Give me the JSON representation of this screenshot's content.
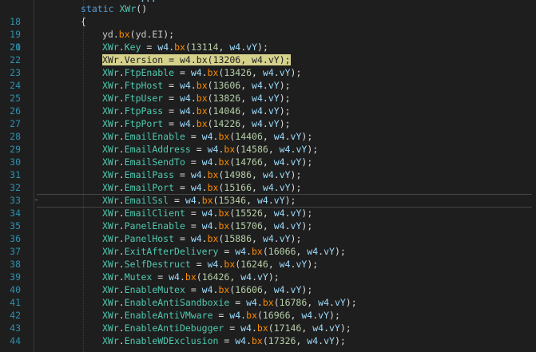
{
  "editor": {
    "method_header": {
      "line": "18",
      "keyword": "static",
      "name": "XWr",
      "parens": "()"
    },
    "open_brace": {
      "line": "19",
      "text": "{"
    },
    "call_line": {
      "line": "20",
      "recv": "yd",
      "method": "bx",
      "arg_recv": "yd",
      "arg_prop": "EI",
      "tail": ");"
    },
    "assignments": [
      {
        "line": "21",
        "cls": "XWr",
        "prop": "Key",
        "value": "13114",
        "highlighted": false
      },
      {
        "line": "22",
        "cls": "XWr",
        "prop": "Version",
        "value": "13206",
        "highlighted": true
      },
      {
        "line": "23",
        "cls": "XWr",
        "prop": "FtpEnable",
        "value": "13426",
        "highlighted": false
      },
      {
        "line": "24",
        "cls": "XWr",
        "prop": "FtpHost",
        "value": "13606",
        "highlighted": false
      },
      {
        "line": "25",
        "cls": "XWr",
        "prop": "FtpUser",
        "value": "13826",
        "highlighted": false
      },
      {
        "line": "26",
        "cls": "XWr",
        "prop": "FtpPass",
        "value": "14046",
        "highlighted": false
      },
      {
        "line": "27",
        "cls": "XWr",
        "prop": "FtpPort",
        "value": "14226",
        "highlighted": false
      },
      {
        "line": "28",
        "cls": "XWr",
        "prop": "EmailEnable",
        "value": "14406",
        "highlighted": false
      },
      {
        "line": "29",
        "cls": "XWr",
        "prop": "EmailAddress",
        "value": "14586",
        "highlighted": false
      },
      {
        "line": "30",
        "cls": "XWr",
        "prop": "EmailSendTo",
        "value": "14766",
        "highlighted": false
      },
      {
        "line": "31",
        "cls": "XWr",
        "prop": "EmailPass",
        "value": "14986",
        "highlighted": false
      },
      {
        "line": "32",
        "cls": "XWr",
        "prop": "EmailPort",
        "value": "15166",
        "highlighted": false
      },
      {
        "line": "33",
        "cls": "XWr",
        "prop": "EmailSsl",
        "value": "15346",
        "highlighted": false,
        "current": true
      },
      {
        "line": "34",
        "cls": "XWr",
        "prop": "EmailClient",
        "value": "15526",
        "highlighted": false
      },
      {
        "line": "35",
        "cls": "XWr",
        "prop": "PanelEnable",
        "value": "15706",
        "highlighted": false
      },
      {
        "line": "36",
        "cls": "XWr",
        "prop": "PanelHost",
        "value": "15886",
        "highlighted": false
      },
      {
        "line": "37",
        "cls": "XWr",
        "prop": "ExitAfterDelivery",
        "value": "16066",
        "highlighted": false
      },
      {
        "line": "38",
        "cls": "XWr",
        "prop": "SelfDestruct",
        "value": "16246",
        "highlighted": false
      },
      {
        "line": "39",
        "cls": "XWr",
        "prop": "Mutex",
        "value": "16426",
        "highlighted": false
      },
      {
        "line": "40",
        "cls": "XWr",
        "prop": "EnableMutex",
        "value": "16606",
        "highlighted": false
      },
      {
        "line": "41",
        "cls": "XWr",
        "prop": "EnableAntiSandboxie",
        "value": "16786",
        "highlighted": false
      },
      {
        "line": "42",
        "cls": "XWr",
        "prop": "EnableAntiVMware",
        "value": "16966",
        "highlighted": false
      },
      {
        "line": "43",
        "cls": "XWr",
        "prop": "EnableAntiDebugger",
        "value": "17146",
        "highlighted": false
      },
      {
        "line": "44",
        "cls": "XWr",
        "prop": "EnableWDExclusion",
        "value": "17326",
        "highlighted": false
      }
    ],
    "call_parts": {
      "eq": " = ",
      "recv": "w4",
      "dot": ".",
      "method": "bx",
      "open": "(",
      "sep": ", ",
      "arg_recv": "w4",
      "arg_prop": "vY",
      "close": ");"
    }
  },
  "colors": {
    "background": "#1e1e1e",
    "line_number": "#2b91af",
    "keyword": "#569cd6",
    "type": "#4ec9b0",
    "method": "#ff8c00",
    "identifier": "#9cdcfe",
    "highlight": "#d6d28c"
  }
}
